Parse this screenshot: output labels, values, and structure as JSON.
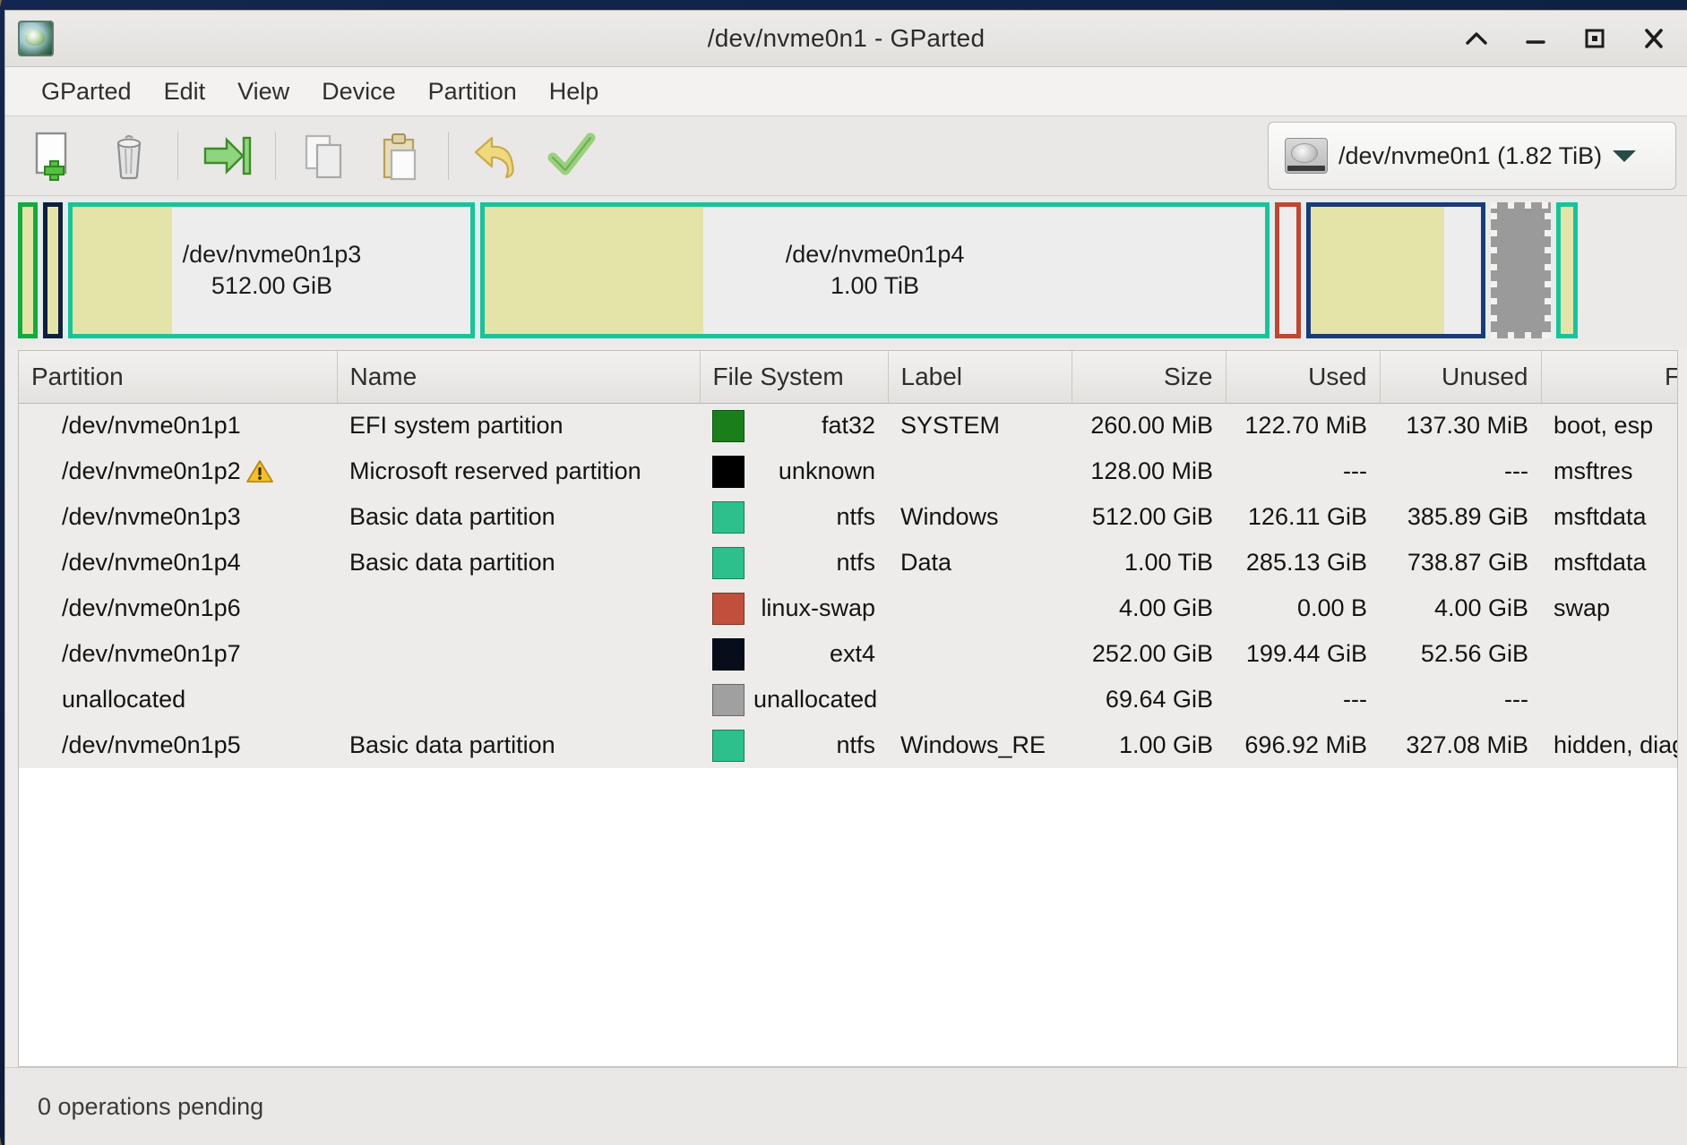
{
  "window": {
    "title": "/dev/nvme0n1 - GParted",
    "app_icon": "gparted-icon",
    "controls": {
      "shade": "^",
      "minimize": "_",
      "maximize": "□",
      "close": "✕"
    }
  },
  "menubar": {
    "items": [
      {
        "label": "GParted"
      },
      {
        "label": "Edit"
      },
      {
        "label": "View"
      },
      {
        "label": "Device"
      },
      {
        "label": "Partition"
      },
      {
        "label": "Help"
      }
    ]
  },
  "toolbar": {
    "buttons": [
      {
        "name": "new-partition-button",
        "icon": "new-document-plus-icon"
      },
      {
        "name": "delete-partition-button",
        "icon": "trash-icon"
      },
      {
        "name": "resize-move-button",
        "icon": "arrow-to-bar-icon"
      },
      {
        "name": "copy-button",
        "icon": "copy-icon"
      },
      {
        "name": "paste-button",
        "icon": "clipboard-paste-icon"
      },
      {
        "name": "undo-button",
        "icon": "undo-arrow-icon"
      },
      {
        "name": "apply-button",
        "icon": "green-check-icon"
      }
    ],
    "device_selector": {
      "icon": "hard-disk-icon",
      "label": "/dev/nvme0n1 (1.82 TiB)",
      "caret": "chevron-down-icon"
    }
  },
  "disk_graphic": {
    "partitions": [
      {
        "name": "",
        "size": "",
        "border": "#14aa3c",
        "fill_used_pct": 100,
        "width_pct": 1.2,
        "label_visible": false
      },
      {
        "name": "",
        "size": "",
        "border": "#0f1f3d",
        "fill_used_pct": 100,
        "width_pct": 1.2,
        "label_visible": false
      },
      {
        "name": "/dev/nvme0n1p3",
        "size": "512.00 GiB",
        "border": "#19c39a",
        "fill_used_pct": 25,
        "width_pct": 24.5,
        "label_visible": true
      },
      {
        "name": "/dev/nvme0n1p4",
        "size": "1.00 TiB",
        "border": "#19c39a",
        "fill_used_pct": 28,
        "width_pct": 47.5,
        "label_visible": true
      },
      {
        "name": "",
        "size": "",
        "border": "#c0462f",
        "fill_used_pct": 0,
        "width_pct": 1.6,
        "label_visible": false
      },
      {
        "name": "",
        "size": "",
        "border": "#1b3a78",
        "fill_used_pct": 78,
        "width_pct": 10.8,
        "label_visible": false
      },
      {
        "name": "",
        "size": "",
        "border": "unallocated",
        "fill_used_pct": 0,
        "width_pct": 3.6,
        "label_visible": false
      },
      {
        "name": "",
        "size": "",
        "border": "#19c39a",
        "fill_used_pct": 100,
        "width_pct": 1.3,
        "label_visible": false
      }
    ]
  },
  "table": {
    "columns": [
      {
        "key": "partition",
        "label": "Partition",
        "align": "left"
      },
      {
        "key": "name",
        "label": "Name",
        "align": "left"
      },
      {
        "key": "filesystem",
        "label": "File System",
        "align": "right"
      },
      {
        "key": "label",
        "label": "Label",
        "align": "left"
      },
      {
        "key": "size",
        "label": "Size",
        "align": "right"
      },
      {
        "key": "used",
        "label": "Used",
        "align": "right"
      },
      {
        "key": "unused",
        "label": "Unused",
        "align": "right"
      },
      {
        "key": "flags",
        "label": "Flags",
        "align": "left"
      }
    ],
    "rows": [
      {
        "partition": "/dev/nvme0n1p1",
        "warning": false,
        "name": "EFI system partition",
        "fs_color": "#1a7f1a",
        "filesystem": "fat32",
        "label": "SYSTEM",
        "size": "260.00 MiB",
        "used": "122.70 MiB",
        "unused": "137.30 MiB",
        "flags": "boot, esp",
        "selected": false
      },
      {
        "partition": "/dev/nvme0n1p2",
        "warning": true,
        "name": "Microsoft reserved partition",
        "fs_color": "#000000",
        "filesystem": "unknown",
        "label": "",
        "size": "128.00 MiB",
        "used": "---",
        "unused": "---",
        "flags": "msftres",
        "selected": false
      },
      {
        "partition": "/dev/nvme0n1p3",
        "warning": false,
        "name": "Basic data partition",
        "fs_color": "#2ec08c",
        "filesystem": "ntfs",
        "label": "Windows",
        "size": "512.00 GiB",
        "used": "126.11 GiB",
        "unused": "385.89 GiB",
        "flags": "msftdata",
        "selected": false
      },
      {
        "partition": "/dev/nvme0n1p4",
        "warning": false,
        "name": "Basic data partition",
        "fs_color": "#2ec08c",
        "filesystem": "ntfs",
        "label": "Data",
        "size": "1.00 TiB",
        "used": "285.13 GiB",
        "unused": "738.87 GiB",
        "flags": "msftdata",
        "selected": false
      },
      {
        "partition": "/dev/nvme0n1p6",
        "warning": false,
        "name": "",
        "fs_color": "#c0503a",
        "filesystem": "linux-swap",
        "label": "",
        "size": "4.00 GiB",
        "used": "0.00 B",
        "unused": "4.00 GiB",
        "flags": "swap",
        "selected": false
      },
      {
        "partition": "/dev/nvme0n1p7",
        "warning": false,
        "name": "",
        "fs_color": "#080d1c",
        "filesystem": "ext4",
        "label": "",
        "size": "252.00 GiB",
        "used": "199.44 GiB",
        "unused": "52.56 GiB",
        "flags": "",
        "selected": false
      },
      {
        "partition": "unallocated",
        "warning": false,
        "name": "",
        "fs_color": "#a0a0a0",
        "filesystem": "unallocated",
        "label": "",
        "size": "69.64 GiB",
        "used": "---",
        "unused": "---",
        "flags": "",
        "selected": true
      },
      {
        "partition": "/dev/nvme0n1p5",
        "warning": false,
        "name": "Basic data partition",
        "fs_color": "#2ec08c",
        "filesystem": "ntfs",
        "label": "Windows_RE",
        "size": "1.00 GiB",
        "used": "696.92 MiB",
        "unused": "327.08 MiB",
        "flags": "hidden, diag,",
        "selected": false
      }
    ]
  },
  "statusbar": {
    "text": "0 operations pending"
  },
  "colors": {
    "selection_blue": "#1874d2",
    "window_chrome": "#edecea",
    "ntfs_green": "#2ec08c",
    "fat32_green": "#1a7f1a",
    "swap_red": "#c0503a",
    "ext4_navy": "#080d1c",
    "unallocated_gray": "#a0a0a0",
    "used_yellow": "#e4e4a8"
  }
}
